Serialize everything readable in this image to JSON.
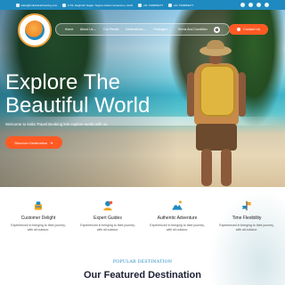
{
  "topbar": {
    "email": "sales@indiatravelbooking.com",
    "address": "C-53, Raghubir Nagar, Tagore Garden Extension, Delhi",
    "phone1": "+91 7303863277",
    "phone2": "+91 7303863277",
    "social_icons": [
      "facebook-icon",
      "twitter-icon",
      "instagram-icon",
      "youtube-icon"
    ]
  },
  "nav": {
    "items": [
      "Home",
      "About Us ⌄",
      "Car Rental",
      "Destinations ⌄",
      "Packages ⌄",
      "Terms And Condition"
    ],
    "contact_label": "Contact Us"
  },
  "hero": {
    "title_line1": "Explore The",
    "title_line2": "Beautiful World",
    "subtitle": "Welcome to India Travel Booking lets explore world with us.",
    "cta_label": "Discover Destination"
  },
  "features": [
    {
      "icon": "customer-delight-icon",
      "title": "Customer Delight",
      "desc_line1": "Experienced in bringing to their journey,",
      "desc_line2": "with all outdoor."
    },
    {
      "icon": "expert-guides-icon",
      "title": "Expert Guides",
      "desc_line1": "Experienced in bringing to their journey,",
      "desc_line2": "with all outdoor."
    },
    {
      "icon": "authentic-adventure-icon",
      "title": "Authentic Adventure",
      "desc_line1": "Experienced in bringing to their journey,",
      "desc_line2": "with all outdoor."
    },
    {
      "icon": "time-flexibility-icon",
      "title": "Time Flexibility",
      "desc_line1": "Experienced in bringing to their journey,",
      "desc_line2": "with all outdoor."
    }
  ],
  "section": {
    "kicker": "POPULAR DESTINATION",
    "title": "Our Featured Destination"
  },
  "colors": {
    "accent": "#ff5a24",
    "brand_blue": "#1f8ac0",
    "heading": "#1c2033"
  }
}
